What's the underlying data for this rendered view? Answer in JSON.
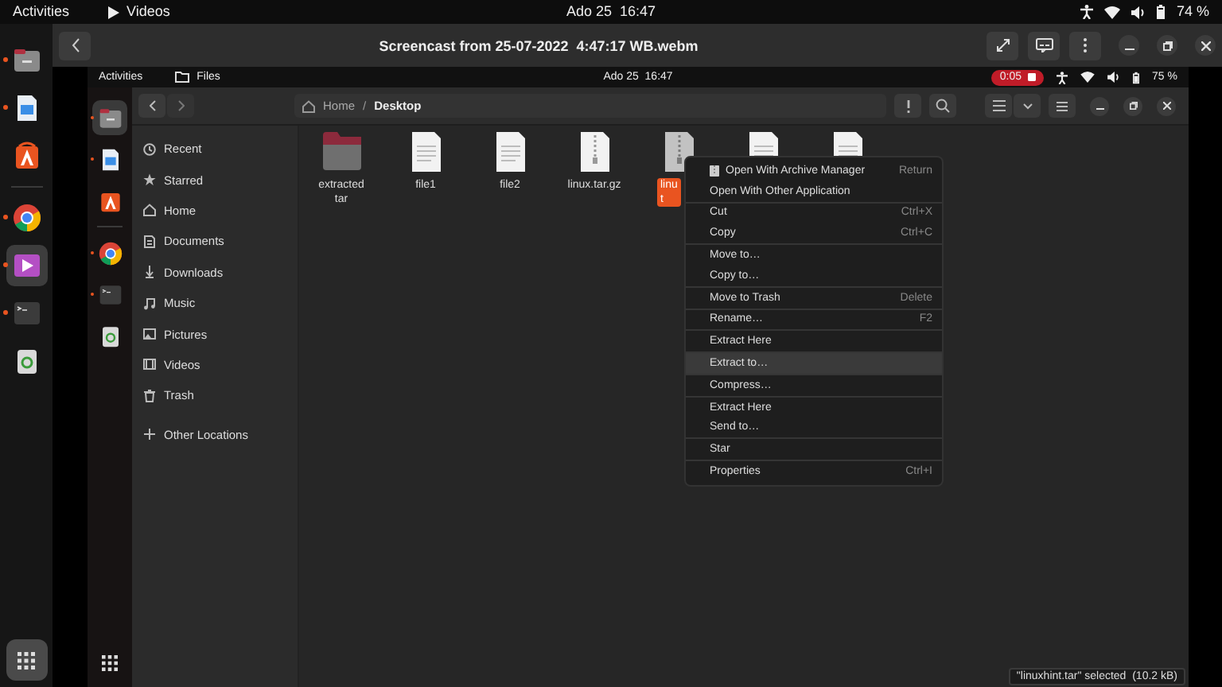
{
  "top_bar": {
    "activities": "Activities",
    "app": "Videos",
    "clock": "Ado 25  16:47",
    "battery": "74 %"
  },
  "dock": {
    "items": [
      {
        "kind": "files",
        "running": true,
        "selected": false
      },
      {
        "kind": "text-editor",
        "running": true,
        "selected": false
      },
      {
        "kind": "app-center",
        "selected": false
      },
      {
        "kind": "separator"
      },
      {
        "kind": "browser",
        "running": true,
        "selected": false
      },
      {
        "kind": "videos",
        "running": true,
        "selected": true
      },
      {
        "kind": "terminal",
        "running": true,
        "selected": false
      },
      {
        "kind": "trash",
        "selected": false
      }
    ]
  },
  "player": {
    "title": "Screencast from 25-07-2022  4:47:17 WB.webm"
  },
  "screencast": {
    "top_bar": {
      "activities": "Activities",
      "app": "Files",
      "clock": "Ado 25  16:47",
      "recording": "0:05",
      "battery": "75 %"
    },
    "dock": {
      "items": [
        {
          "kind": "files",
          "running": true,
          "selected": true
        },
        {
          "kind": "text-editor",
          "running": true,
          "selected": false
        },
        {
          "kind": "app-center",
          "selected": false
        },
        {
          "kind": "separator"
        },
        {
          "kind": "browser",
          "running": true,
          "selected": false
        },
        {
          "kind": "terminal",
          "running": true,
          "selected": false
        },
        {
          "kind": "trash",
          "selected": false
        }
      ]
    },
    "files": {
      "path": [
        {
          "label": "Home"
        },
        {
          "label": "Desktop"
        }
      ],
      "path_separator": "/",
      "sidebar": [
        {
          "kind": "recent",
          "label": "Recent"
        },
        {
          "kind": "starred",
          "label": "Starred"
        },
        {
          "kind": "home",
          "label": "Home"
        },
        {
          "kind": "documents",
          "label": "Documents"
        },
        {
          "kind": "downloads",
          "label": "Downloads"
        },
        {
          "kind": "music",
          "label": "Music"
        },
        {
          "kind": "pictures",
          "label": "Pictures"
        },
        {
          "kind": "videos",
          "label": "Videos"
        },
        {
          "kind": "trash",
          "label": "Trash"
        },
        {
          "kind": "other",
          "label": "Other Locations"
        }
      ],
      "items": [
        {
          "kind": "folder",
          "label": [
            "extracted",
            "tar"
          ],
          "selected": false
        },
        {
          "kind": "text",
          "label": [
            "file1"
          ],
          "selected": false
        },
        {
          "kind": "text",
          "label": [
            "file2"
          ],
          "selected": false
        },
        {
          "kind": "archive",
          "label": [
            "linux.tar.gz"
          ],
          "selected": false
        },
        {
          "kind": "archive",
          "label": [
            "linu",
            "t"
          ],
          "selected": true
        },
        {
          "kind": "text",
          "selected": false
        },
        {
          "kind": "text",
          "selected": false
        }
      ],
      "context_menu": {
        "groups": [
          [
            {
              "label": "Open With Archive Manager",
              "shortcut": "Return",
              "icon": true,
              "selected": false
            },
            {
              "label": "Open With Other Application",
              "selected": false
            }
          ],
          [
            {
              "label": "Cut",
              "shortcut": "Ctrl+X",
              "selected": false
            },
            {
              "label": "Copy",
              "shortcut": "Ctrl+C",
              "selected": false
            }
          ],
          [
            {
              "label": "Move to…",
              "selected": false
            },
            {
              "label": "Copy to…",
              "selected": false
            }
          ],
          [
            {
              "label": "Move to Trash",
              "shortcut": "Delete",
              "selected": false
            }
          ],
          [
            {
              "label": "Rename…",
              "shortcut": "F2",
              "selected": false
            }
          ],
          [
            {
              "label": "Extract Here",
              "selected": false
            }
          ],
          [
            {
              "label": "Extract to…",
              "selected": true
            }
          ],
          [
            {
              "label": "Compress…",
              "selected": false
            }
          ],
          [
            {
              "label": "Extract Here",
              "selected": false
            },
            {
              "label": "Send to…",
              "selected": false
            }
          ],
          [
            {
              "label": "Star",
              "selected": false
            }
          ],
          [
            {
              "label": "Properties",
              "shortcut": "Ctrl+I",
              "selected": false
            }
          ]
        ]
      },
      "status": "\"linuxhint.tar\" selected  (10.2 kB)"
    }
  }
}
